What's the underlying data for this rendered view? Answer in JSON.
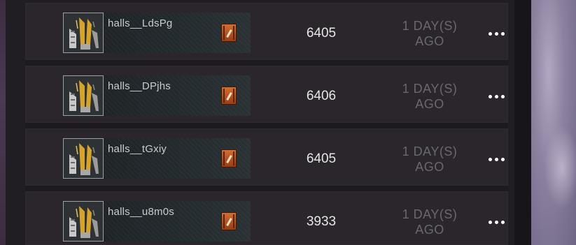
{
  "rows": [
    {
      "name": "halls__LdsPg",
      "score": "6405",
      "time_line1": "1 DAY(S)",
      "time_line2": "AGO"
    },
    {
      "name": "halls__DPjhs",
      "score": "6406",
      "time_line1": "1 DAY(S)",
      "time_line2": "AGO"
    },
    {
      "name": "halls__tGxiy",
      "score": "6405",
      "time_line1": "1 DAY(S)",
      "time_line2": "AGO"
    },
    {
      "name": "halls__u8m0s",
      "score": "3933",
      "time_line1": "1 DAY(S)",
      "time_line2": "AGO"
    }
  ],
  "icons": {
    "item": "claw-weapon-icon",
    "badge": "rank-badge-icon",
    "menu": "more-options-icon"
  },
  "colors": {
    "score_text": "#e6e6e6",
    "time_text": "#6a686e",
    "badge_orange": "#d56e2e",
    "row_background": "#2a262c"
  }
}
